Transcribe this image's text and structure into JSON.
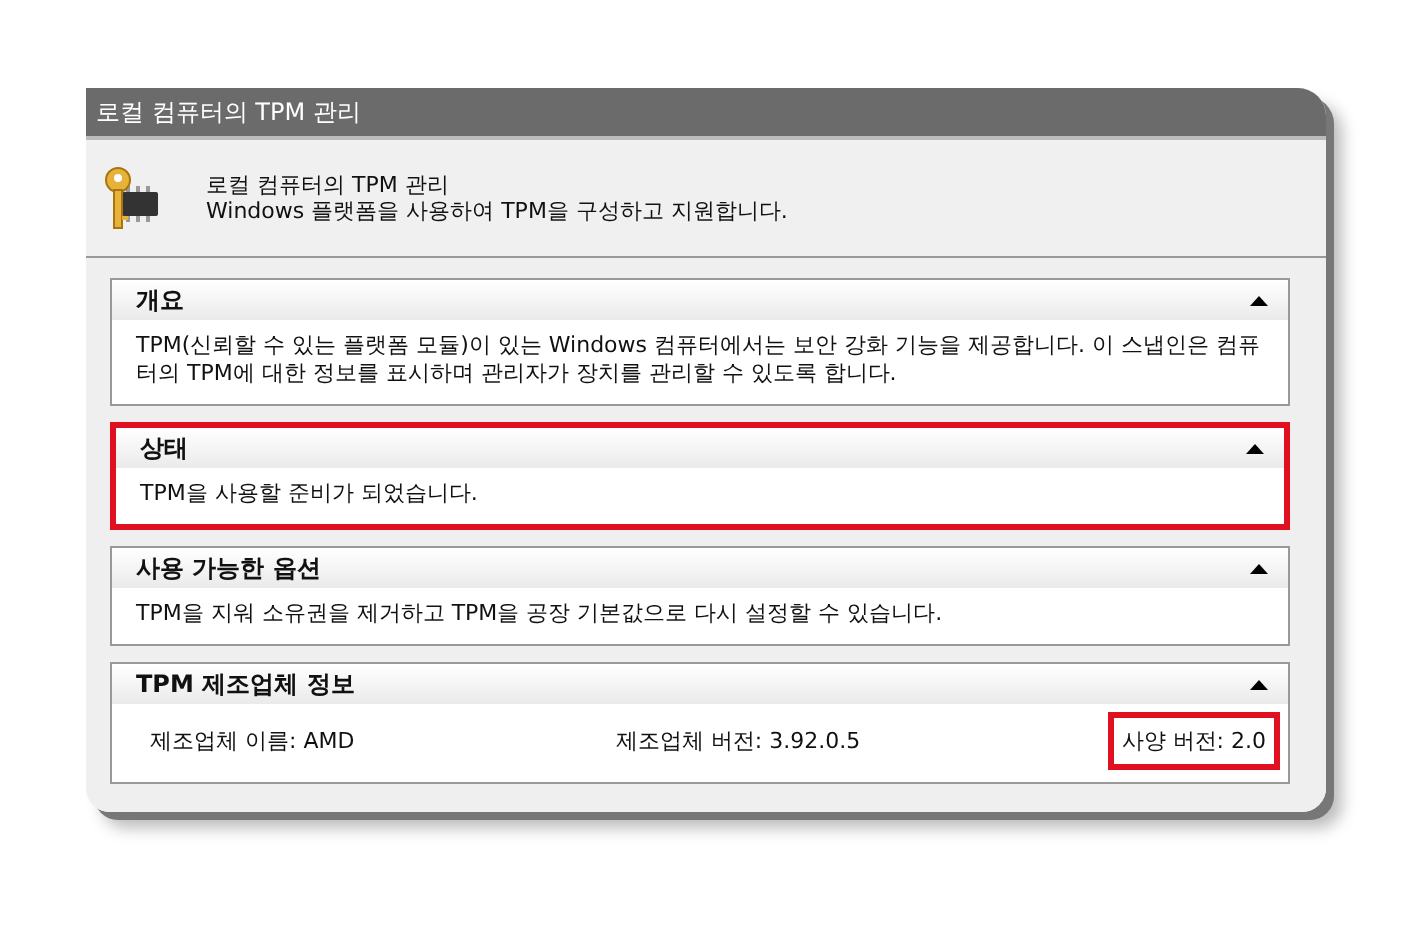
{
  "window": {
    "title": "로컬 컴퓨터의 TPM 관리"
  },
  "header": {
    "title": "로컬 컴퓨터의 TPM 관리",
    "subtitle": "Windows 플랫폼을 사용하여 TPM을 구성하고 지원합니다."
  },
  "sections": [
    {
      "title": "개요",
      "highlighted": false,
      "kind": "text",
      "text": "TPM(신뢰할 수 있는 플랫폼 모듈)이 있는 Windows 컴퓨터에서는 보안 강화 기능을 제공합니다. 이 스냅인은 컴퓨터의 TPM에 대한 정보를 표시하며 관리자가 장치를 관리할 수 있도록 합니다."
    },
    {
      "title": "상태",
      "highlighted": true,
      "kind": "text",
      "text": "TPM을 사용할 준비가 되었습니다."
    },
    {
      "title": "사용 가능한 옵션",
      "highlighted": false,
      "kind": "text",
      "text": "TPM을 지워 소유권을 제거하고 TPM을 공장 기본값으로 다시 설정할 수 있습니다."
    },
    {
      "title": "TPM 제조업체 정보",
      "highlighted": false,
      "kind": "fields",
      "fields": [
        {
          "text": "제조업체 이름: AMD",
          "highlighted": false
        },
        {
          "text": "제조업체 버전: 3.92.0.5",
          "highlighted": false
        },
        {
          "text": "사양 버전: 2.0",
          "highlighted": true
        }
      ]
    }
  ]
}
